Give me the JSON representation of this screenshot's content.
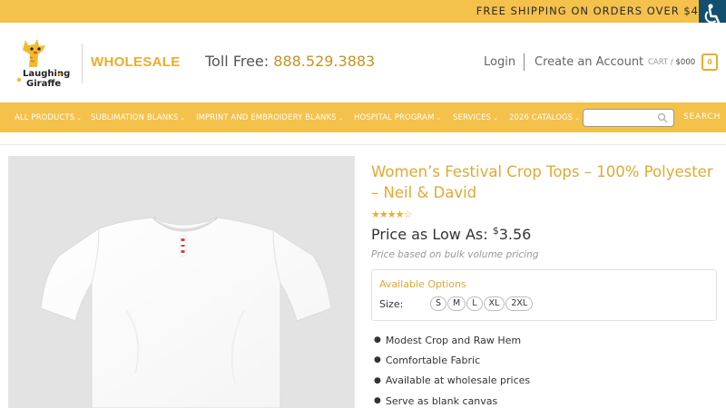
{
  "topbar": {
    "shipping_text": "FREE SHIPPING ON ORDERS OVER $4"
  },
  "header": {
    "brand_line1": "Laughing",
    "brand_line2": "Giraffe",
    "wholesale": "WHOLESALE",
    "tollfree_label": "Toll Free:",
    "tollfree_number": "888.529.3883",
    "login": "Login",
    "create_account": "Create an Account",
    "cart_label": "CART /",
    "cart_amount": "$000",
    "cart_count": "0"
  },
  "nav": {
    "items": [
      "ALL PRODUCTS",
      "SUBLIMATION BLANKS",
      "IMPRINT AND EMBROIDERY BLANKS",
      "HOSPITAL PROGRAM",
      "SERVICES",
      "2026 CATALOGS"
    ],
    "search_placeholder": "",
    "search_button": "SEARCH"
  },
  "product": {
    "title": "Women’s Festival Crop Tops – 100% Polyester – Neil & David",
    "rating": 4,
    "rating_max": 5,
    "price_label": "Price as Low As:",
    "price_currency": "$",
    "price_value": "3.56",
    "price_note": "Price based on bulk volume pricing",
    "options_header": "Available Options",
    "size_label": "Size:",
    "sizes": [
      "S",
      "M",
      "L",
      "XL",
      "2XL"
    ],
    "features": [
      "Modest Crop and Raw Hem",
      "Comfortable Fabric",
      "Available at wholesale prices",
      "Serve as blank canvas"
    ]
  },
  "colors": {
    "accent": "#f4c14b",
    "accent_text": "#e3a832",
    "a11y_bg": "#124e6e"
  }
}
